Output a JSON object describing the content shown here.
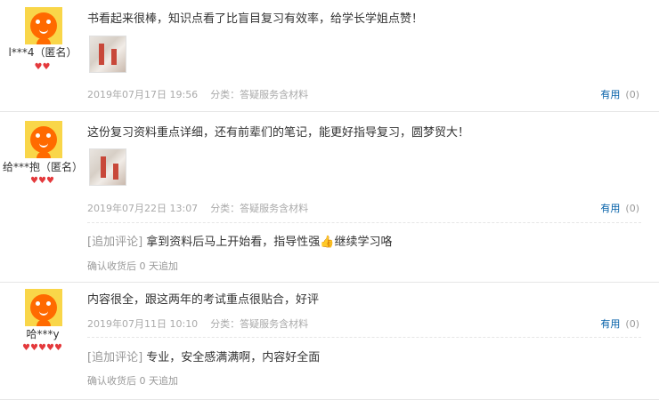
{
  "reviews": [
    {
      "username": "l***4（匿名）",
      "rank_hearts": 2,
      "text": "书看起来很棒，知识点看了比盲目复习有效率，给学长学姐点赞！",
      "has_image": true,
      "date": "2019年07月17日 19:56",
      "category": "分类：答疑服务含材料",
      "useful_label": "有用",
      "useful_count": "(0)"
    },
    {
      "username": "给***抱（匿名）",
      "rank_hearts": 3,
      "text": "这份复习资料重点详细，还有前辈们的笔记，能更好指导复习，圆梦贸大！",
      "has_image": true,
      "date": "2019年07月22日 13:07",
      "category": "分类：答疑服务含材料",
      "useful_label": "有用",
      "useful_count": "(0)",
      "additional": {
        "tag": "[追加评论]",
        "text": "拿到资料后马上开始看，指导性强👍继续学习咯",
        "time": "确认收货后 0 天追加"
      }
    },
    {
      "username": "哈***y",
      "rank_hearts": 5,
      "text": "内容很全，跟这两年的考试重点很贴合，好评",
      "has_image": false,
      "date": "2019年07月11日 10:10",
      "category": "分类：答疑服务含材料",
      "useful_label": "有用",
      "useful_count": "(0)",
      "additional": {
        "tag": "[追加评论]",
        "text": "专业，安全感满满啊，内容好全面",
        "time": "确认收货后 0 天追加"
      }
    }
  ],
  "colors": {
    "useful_link": "#005ea7",
    "heart": "#e4393c",
    "avatar_bg": "#f9d649",
    "avatar_figure": "#ff6a00"
  },
  "icons": [
    "avatar-icon",
    "heart-icon",
    "thumbs-up-emoji"
  ]
}
